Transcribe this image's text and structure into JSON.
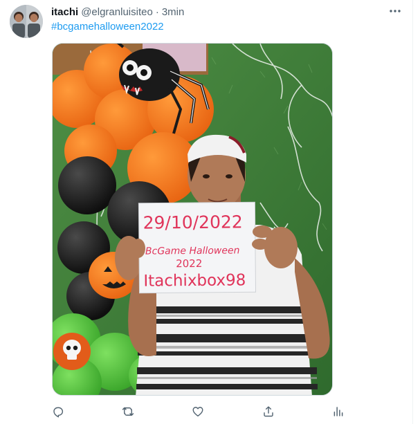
{
  "tweet": {
    "display_name": "itachi",
    "handle": "@elgranluisiteo",
    "separator": "·",
    "time": "3min",
    "hashtag": "#bcgamehalloween2022"
  },
  "sign": {
    "line1": "29/10/2022",
    "line2": "BcGame Halloween",
    "line3": "2022",
    "line4": "Itachixbox98"
  },
  "icons": {
    "more": "more-icon",
    "reply": "reply-icon",
    "retweet": "retweet-icon",
    "like": "heart-icon",
    "share": "share-icon",
    "analytics": "analytics-icon"
  },
  "colors": {
    "link": "#1d9bf0",
    "secondary_text": "#536471",
    "icon": "#536471",
    "sign_ink": "#e0345a"
  }
}
